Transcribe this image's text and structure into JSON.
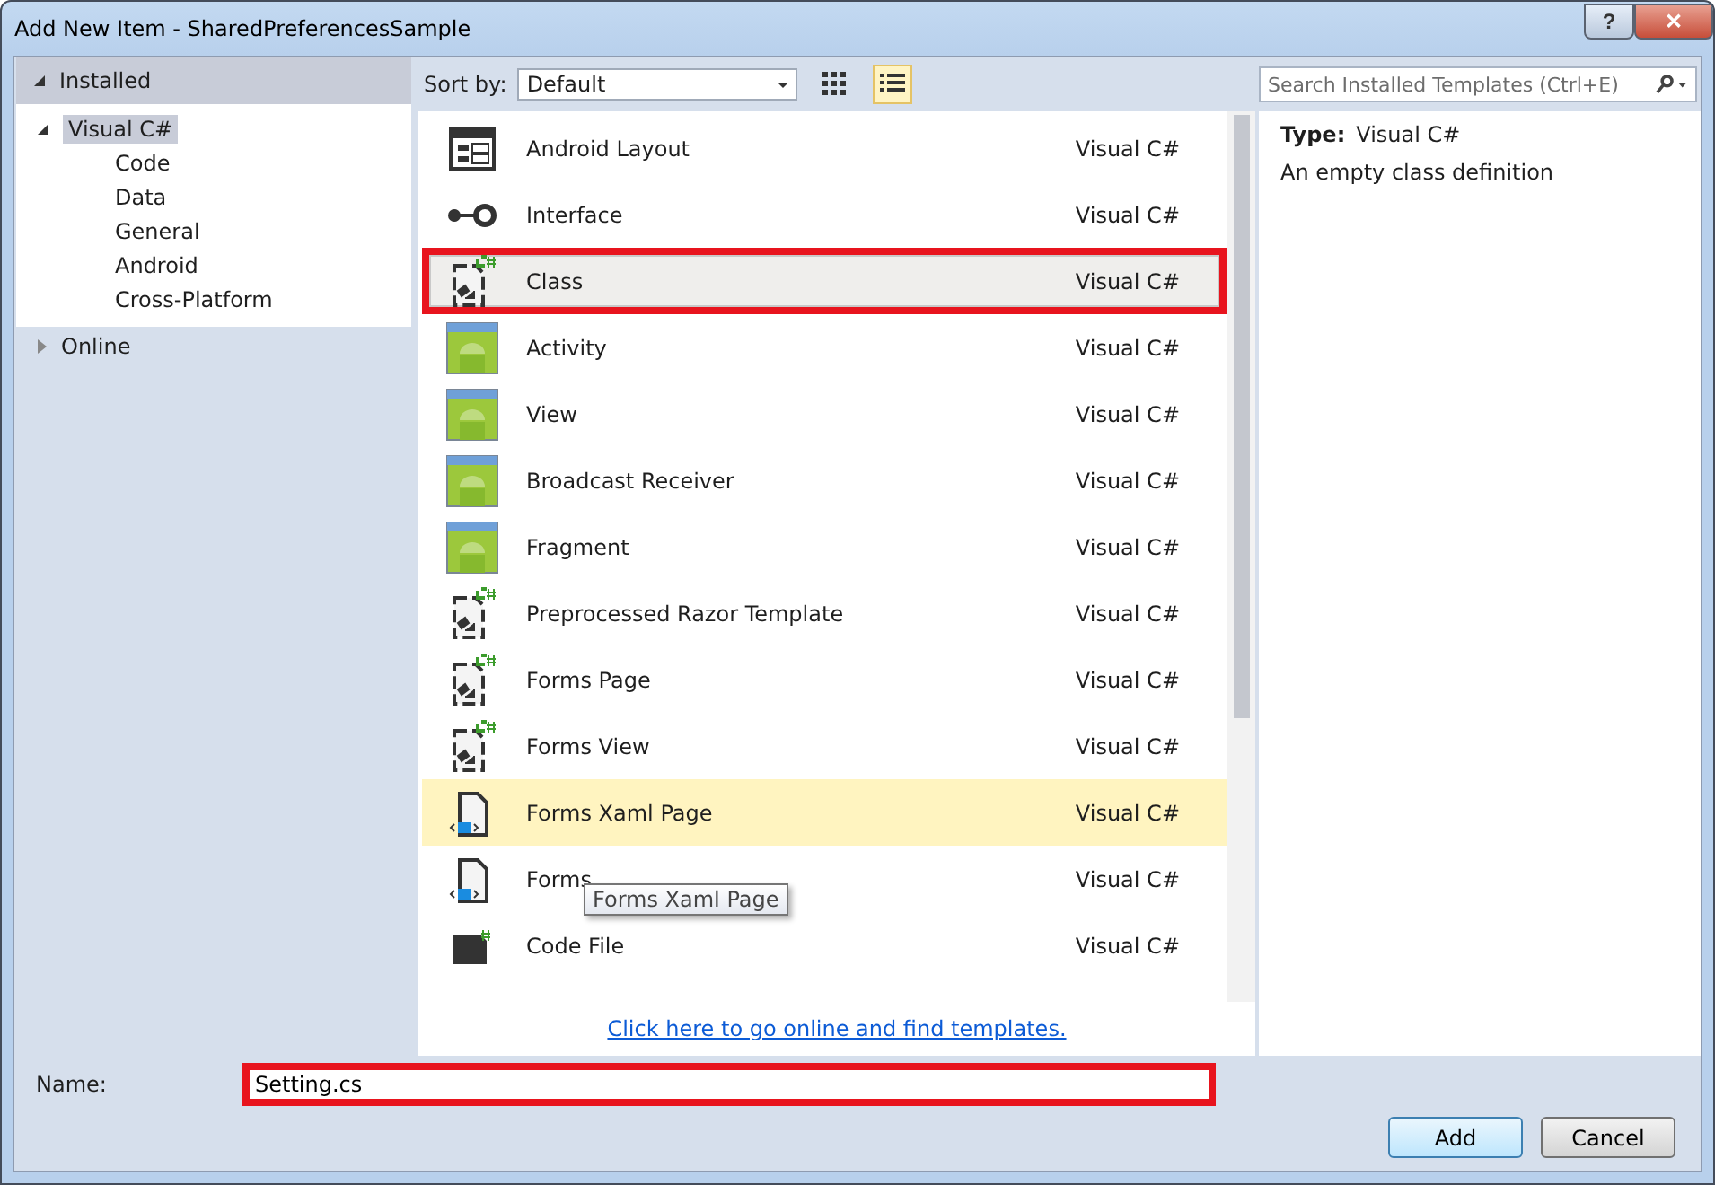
{
  "window": {
    "title": "Add New Item - SharedPreferencesSample",
    "help": "?",
    "close": "✕"
  },
  "sidebar": {
    "header": {
      "label": "Installed",
      "expanded": true
    },
    "tree": [
      {
        "label": "Visual C#",
        "expanded": true,
        "selected": true,
        "children": [
          {
            "label": "Code",
            "selected": false
          },
          {
            "label": "Data",
            "selected": false
          },
          {
            "label": "General",
            "selected": false
          },
          {
            "label": "Android",
            "selected": false
          },
          {
            "label": "Cross-Platform",
            "selected": false
          }
        ]
      }
    ],
    "online": {
      "label": "Online",
      "expanded": false
    }
  },
  "toolbar": {
    "sort_label": "Sort by:",
    "sort_value": "Default",
    "view": [
      {
        "kind": "grid",
        "selected": false
      },
      {
        "kind": "list",
        "selected": true
      }
    ]
  },
  "search": {
    "placeholder": "Search Installed Templates (Ctrl+E)"
  },
  "templates": [
    {
      "kind": "layout",
      "name": "Android Layout",
      "language": "Visual C#",
      "selected": false,
      "hovered": false,
      "highlighted": false
    },
    {
      "kind": "interface",
      "name": "Interface",
      "language": "Visual C#",
      "selected": false,
      "hovered": false,
      "highlighted": false
    },
    {
      "kind": "csharp",
      "name": "Class",
      "language": "Visual C#",
      "selected": true,
      "hovered": false,
      "highlighted": true
    },
    {
      "kind": "android",
      "name": "Activity",
      "language": "Visual C#",
      "selected": false,
      "hovered": false,
      "highlighted": false
    },
    {
      "kind": "android",
      "name": "View",
      "language": "Visual C#",
      "selected": false,
      "hovered": false,
      "highlighted": false
    },
    {
      "kind": "android",
      "name": "Broadcast Receiver",
      "language": "Visual C#",
      "selected": false,
      "hovered": false,
      "highlighted": false
    },
    {
      "kind": "android",
      "name": "Fragment",
      "language": "Visual C#",
      "selected": false,
      "hovered": false,
      "highlighted": false
    },
    {
      "kind": "csharp",
      "name": "Preprocessed Razor Template",
      "language": "Visual C#",
      "selected": false,
      "hovered": false,
      "highlighted": false
    },
    {
      "kind": "csharp",
      "name": "Forms Page",
      "language": "Visual C#",
      "selected": false,
      "hovered": false,
      "highlighted": false
    },
    {
      "kind": "csharp",
      "name": "Forms View",
      "language": "Visual C#",
      "selected": false,
      "hovered": false,
      "highlighted": false
    },
    {
      "kind": "xaml",
      "name": "Forms Xaml Page",
      "language": "Visual C#",
      "selected": false,
      "hovered": true,
      "highlighted": false
    },
    {
      "kind": "xaml",
      "name": "Forms",
      "language": "Visual C#",
      "selected": false,
      "hovered": false,
      "highlighted": false
    },
    {
      "kind": "code",
      "name": "Code File",
      "language": "Visual C#",
      "selected": false,
      "hovered": false,
      "highlighted": false
    }
  ],
  "tooltip": {
    "text": "Forms Xaml Page"
  },
  "online_link": "Click here to go online and find templates.",
  "details": {
    "type_label": "Type:",
    "type_value": "Visual C#",
    "description": "An empty class definition"
  },
  "name_field": {
    "label": "Name:",
    "value": "Setting.cs",
    "highlighted": true
  },
  "buttons": [
    {
      "label": "Add",
      "default": true
    },
    {
      "label": "Cancel",
      "default": false
    }
  ]
}
